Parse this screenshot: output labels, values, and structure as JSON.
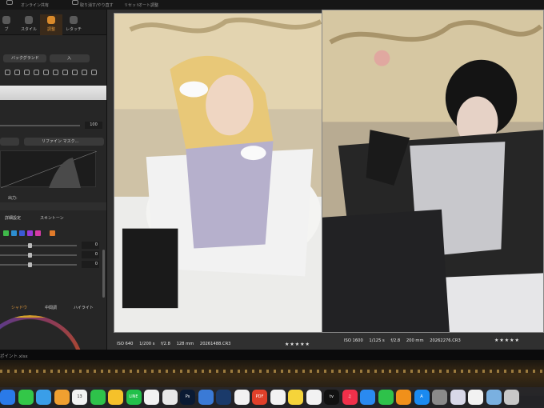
{
  "topbar": {
    "items": [
      "オンライン共有",
      "取り消す/やり直す",
      "リセット",
      "オート調整"
    ],
    "viewer_mode": "イメージ レイヤー"
  },
  "left_panel": {
    "tabs": [
      {
        "label": "ライブラリ",
        "short": "ブ",
        "active": false
      },
      {
        "label": "スタイル",
        "short": "スタイル",
        "active": false
      },
      {
        "label": "調整",
        "short": "調整",
        "active": true
      },
      {
        "label": "レタッチ",
        "short": "レタッチ",
        "active": false
      }
    ],
    "layer_button": "バックグランド",
    "layer_select": "入",
    "slider_value": "100",
    "refine_mask": "リファイン マスク...",
    "output_label": "出力: ",
    "detail_label": "詳細設定",
    "skin_tone": "スキントーン",
    "swatch_colors": [
      "#3fb94a",
      "#2d8ecf",
      "#3a5ad6",
      "#9a3ad6",
      "#d63aa6",
      "#e07a2a"
    ],
    "sliders": [
      {
        "value": "0",
        "knob": 0.36
      },
      {
        "value": "0",
        "knob": 0.36
      },
      {
        "value": "0",
        "knob": 0.36
      }
    ],
    "tone_tabs": [
      {
        "label": "シャドウ",
        "active": true
      },
      {
        "label": "中間調",
        "active": false
      },
      {
        "label": "ハイライト",
        "active": false
      }
    ]
  },
  "photos": [
    {
      "iso": "ISO 640",
      "shutter": "1/200 s",
      "aperture": "f/2.8",
      "focal": "128 mm",
      "filename": "20261488.CR3",
      "rating": "★★★★★"
    },
    {
      "iso": "ISO 1600",
      "shutter": "1/125 s",
      "aperture": "f/2.8",
      "focal": "200 mm",
      "filename": "20262276.CR3",
      "rating": "★★★★★"
    }
  ],
  "footer": {
    "filename": "ポイント.xlsx"
  },
  "dock": {
    "apps": [
      {
        "icon": "finder-icon",
        "color": "#2a7ae8",
        "label": ""
      },
      {
        "icon": "messages-icon",
        "color": "#33c748",
        "label": ""
      },
      {
        "icon": "safari-icon",
        "color": "#3a9ee8",
        "label": ""
      },
      {
        "icon": "photos-icon",
        "color": "#f0a030",
        "label": ""
      },
      {
        "icon": "calendar-icon",
        "color": "#f2f2f2",
        "label": "13"
      },
      {
        "icon": "facetime-icon",
        "color": "#2ec24a",
        "label": ""
      },
      {
        "icon": "notes-icon",
        "color": "#f5c12a",
        "label": ""
      },
      {
        "icon": "line-icon",
        "color": "#22c04a",
        "label": "LINE"
      },
      {
        "icon": "chrome-icon",
        "color": "#f2f2f2",
        "label": ""
      },
      {
        "icon": "capture-one-icon",
        "color": "#e8e8e8",
        "label": ""
      },
      {
        "icon": "photoshop-icon",
        "color": "#0a1a33",
        "label": "Ps"
      },
      {
        "icon": "preview-icon",
        "color": "#3a7ad6",
        "label": ""
      },
      {
        "icon": "zoom-icon",
        "color": "#1a3a6a",
        "label": ""
      },
      {
        "icon": "capcut-icon",
        "color": "#f2f2f2",
        "label": ""
      },
      {
        "icon": "pdf-icon",
        "color": "#e0402a",
        "label": "PDF"
      },
      {
        "icon": "contacts-icon",
        "color": "#f2f2f2",
        "label": ""
      },
      {
        "icon": "stickies-icon",
        "color": "#f5d43a",
        "label": ""
      },
      {
        "icon": "freeform-icon",
        "color": "#f2f2f2",
        "label": ""
      },
      {
        "icon": "apple-tv-icon",
        "color": "#111111",
        "label": "tv"
      },
      {
        "icon": "music-icon",
        "color": "#f0304a",
        "label": "♫"
      },
      {
        "icon": "keynote-icon",
        "color": "#2a8af0",
        "label": ""
      },
      {
        "icon": "numbers-icon",
        "color": "#2ec24a",
        "label": ""
      },
      {
        "icon": "pages-icon",
        "color": "#f0901a",
        "label": ""
      },
      {
        "icon": "app-store-icon",
        "color": "#1a8af0",
        "label": "A"
      },
      {
        "icon": "settings-icon",
        "color": "#8a8a8a",
        "label": ""
      },
      {
        "icon": "launchpad-icon",
        "color": "#d8d8e8",
        "label": ""
      },
      {
        "icon": "folder-icon",
        "color": "#f2f2f2",
        "label": ""
      },
      {
        "icon": "image-icon",
        "color": "#7ab0e0",
        "label": ""
      },
      {
        "icon": "trash-icon",
        "color": "#c8c8c8",
        "label": ""
      }
    ]
  }
}
